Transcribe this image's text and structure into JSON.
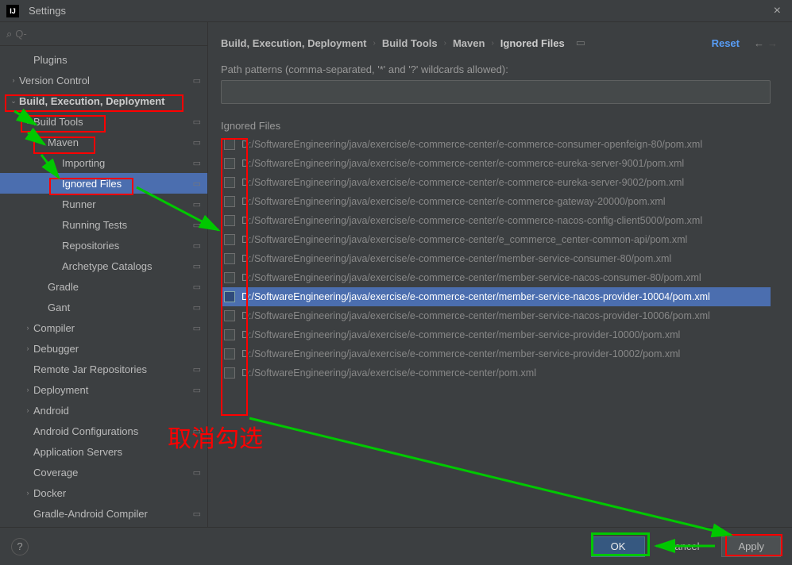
{
  "window": {
    "title": "Settings"
  },
  "search": {
    "placeholder": "Q-"
  },
  "sidebar": {
    "items": [
      {
        "label": "Plugins",
        "lvl": 1,
        "arrow": "",
        "bold": false,
        "opts": false
      },
      {
        "label": "Version Control",
        "lvl": 0,
        "arrow": "›",
        "bold": false,
        "opts": true
      },
      {
        "label": "Build, Execution, Deployment",
        "lvl": 0,
        "arrow": "⌄",
        "bold": true,
        "opts": false
      },
      {
        "label": "Build Tools",
        "lvl": 1,
        "arrow": "⌄",
        "bold": false,
        "opts": true
      },
      {
        "label": "Maven",
        "lvl": 2,
        "arrow": "⌄",
        "bold": false,
        "opts": true
      },
      {
        "label": "Importing",
        "lvl": 3,
        "arrow": "",
        "bold": false,
        "opts": true
      },
      {
        "label": "Ignored Files",
        "lvl": 3,
        "arrow": "",
        "bold": false,
        "opts": true,
        "sel": true
      },
      {
        "label": "Runner",
        "lvl": 3,
        "arrow": "",
        "bold": false,
        "opts": true
      },
      {
        "label": "Running Tests",
        "lvl": 3,
        "arrow": "",
        "bold": false,
        "opts": true
      },
      {
        "label": "Repositories",
        "lvl": 3,
        "arrow": "",
        "bold": false,
        "opts": true
      },
      {
        "label": "Archetype Catalogs",
        "lvl": 3,
        "arrow": "",
        "bold": false,
        "opts": true
      },
      {
        "label": "Gradle",
        "lvl": 2,
        "arrow": "",
        "bold": false,
        "opts": true
      },
      {
        "label": "Gant",
        "lvl": 2,
        "arrow": "",
        "bold": false,
        "opts": true
      },
      {
        "label": "Compiler",
        "lvl": 1,
        "arrow": "›",
        "bold": false,
        "opts": true
      },
      {
        "label": "Debugger",
        "lvl": 1,
        "arrow": "›",
        "bold": false,
        "opts": false
      },
      {
        "label": "Remote Jar Repositories",
        "lvl": 1,
        "arrow": "",
        "bold": false,
        "opts": true
      },
      {
        "label": "Deployment",
        "lvl": 1,
        "arrow": "›",
        "bold": false,
        "opts": true
      },
      {
        "label": "Android",
        "lvl": 1,
        "arrow": "›",
        "bold": false,
        "opts": false
      },
      {
        "label": "Android Configurations",
        "lvl": 1,
        "arrow": "",
        "bold": false,
        "opts": true
      },
      {
        "label": "Application Servers",
        "lvl": 1,
        "arrow": "",
        "bold": false,
        "opts": false
      },
      {
        "label": "Coverage",
        "lvl": 1,
        "arrow": "",
        "bold": false,
        "opts": true
      },
      {
        "label": "Docker",
        "lvl": 1,
        "arrow": "›",
        "bold": false,
        "opts": false
      },
      {
        "label": "Gradle-Android Compiler",
        "lvl": 1,
        "arrow": "",
        "bold": false,
        "opts": true
      }
    ]
  },
  "breadcrumbs": [
    "Build, Execution, Deployment",
    "Build Tools",
    "Maven",
    "Ignored Files"
  ],
  "reset": "Reset",
  "patterns": {
    "label": "Path patterns (comma-separated, '*' and '?' wildcards allowed):"
  },
  "ignored": {
    "label": "Ignored Files",
    "rows": [
      {
        "path": "D:/SoftwareEngineering/java/exercise/e-commerce-center/e-commerce-consumer-openfeign-80/pom.xml"
      },
      {
        "path": "D:/SoftwareEngineering/java/exercise/e-commerce-center/e-commerce-eureka-server-9001/pom.xml"
      },
      {
        "path": "D:/SoftwareEngineering/java/exercise/e-commerce-center/e-commerce-eureka-server-9002/pom.xml"
      },
      {
        "path": "D:/SoftwareEngineering/java/exercise/e-commerce-center/e-commerce-gateway-20000/pom.xml"
      },
      {
        "path": "D:/SoftwareEngineering/java/exercise/e-commerce-center/e-commerce-nacos-config-client5000/pom.xml"
      },
      {
        "path": "D:/SoftwareEngineering/java/exercise/e-commerce-center/e_commerce_center-common-api/pom.xml"
      },
      {
        "path": "D:/SoftwareEngineering/java/exercise/e-commerce-center/member-service-consumer-80/pom.xml"
      },
      {
        "path": "D:/SoftwareEngineering/java/exercise/e-commerce-center/member-service-nacos-consumer-80/pom.xml"
      },
      {
        "path": "D:/SoftwareEngineering/java/exercise/e-commerce-center/member-service-nacos-provider-10004/pom.xml",
        "sel": true
      },
      {
        "path": "D:/SoftwareEngineering/java/exercise/e-commerce-center/member-service-nacos-provider-10006/pom.xml"
      },
      {
        "path": "D:/SoftwareEngineering/java/exercise/e-commerce-center/member-service-provider-10000/pom.xml"
      },
      {
        "path": "D:/SoftwareEngineering/java/exercise/e-commerce-center/member-service-provider-10002/pom.xml"
      },
      {
        "path": "D:/SoftwareEngineering/java/exercise/e-commerce-center/pom.xml"
      }
    ]
  },
  "buttons": {
    "ok": "OK",
    "cancel": "Cancel",
    "apply": "Apply"
  },
  "annotation_text": "取消勾选"
}
